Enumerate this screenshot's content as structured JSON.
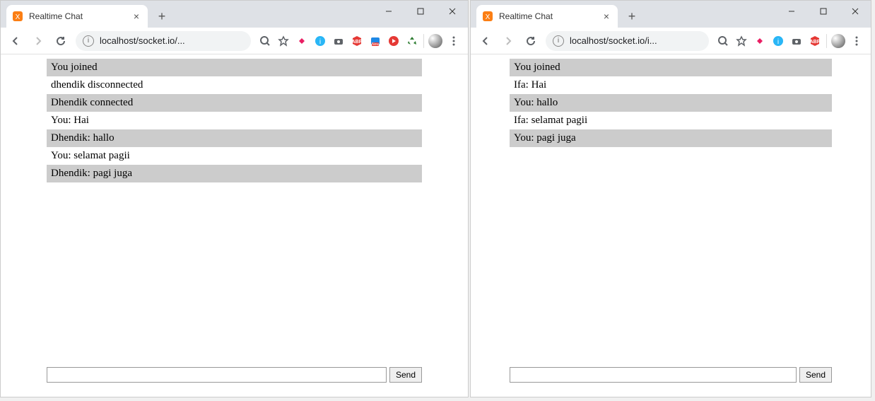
{
  "windows": [
    {
      "tab_title": "Realtime Chat",
      "url": "localhost/socket.io/...",
      "messages": [
        "You joined",
        "dhendik disconnected",
        "Dhendik connected",
        "You: Hai",
        "Dhendik: hallo",
        "You: selamat pagii",
        "Dhendik: pagi juga"
      ],
      "send_label": "Send"
    },
    {
      "tab_title": "Realtime Chat",
      "url": "localhost/socket.io/i...",
      "messages": [
        "You joined",
        "Ifa: Hai",
        "You: hallo",
        "Ifa: selamat pagii",
        "You: pagi juga"
      ],
      "send_label": "Send"
    }
  ]
}
